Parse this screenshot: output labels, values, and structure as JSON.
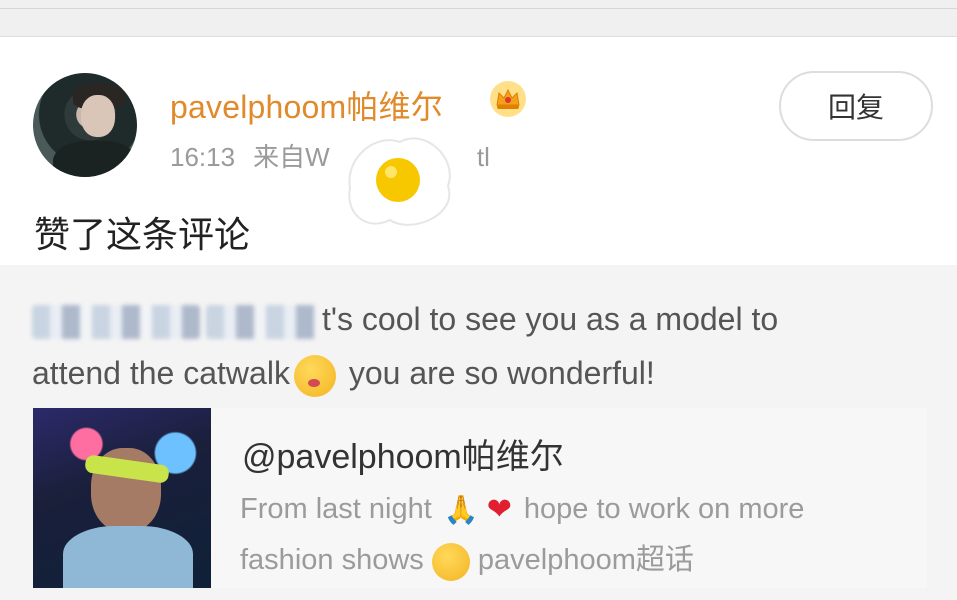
{
  "post": {
    "username": "pavelphoom帕维尔",
    "time": "16:13",
    "source": "来自W",
    "source_tail": "tl",
    "reply_label": "回复",
    "action_text": "赞了这条评论"
  },
  "comment": {
    "text_part1": "t's cool to see you as a model to",
    "text_part2": "attend the catwalk",
    "text_part3": " you are so wonderful!"
  },
  "repost": {
    "mention": "@pavelphoom帕维尔",
    "text1": "From last night ",
    "text2": " hope to work on more",
    "text3": "fashion shows ",
    "topic": " pavelphoom超话"
  },
  "icons": {
    "crown": "crown-badge-icon",
    "egg": "fried-egg-sticker",
    "pray": "🙏",
    "heart": "❤"
  }
}
